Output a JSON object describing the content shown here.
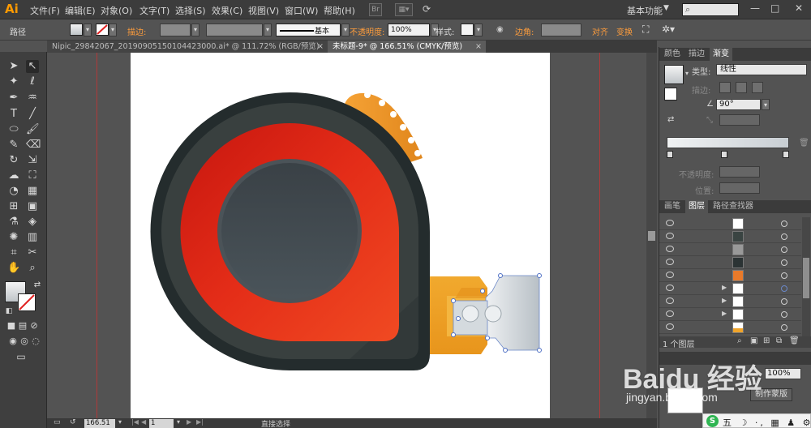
{
  "app": {
    "logo": "Ai"
  },
  "menu": {
    "items": [
      "文件(F)",
      "编辑(E)",
      "对象(O)",
      "文字(T)",
      "选择(S)",
      "效果(C)",
      "视图(V)",
      "窗口(W)",
      "帮助(H)"
    ],
    "br_label": "Br",
    "workspace": "基本功能"
  },
  "controlbar": {
    "selection_label": "路径",
    "stroke_label": "描边:",
    "stroke_style": "基本",
    "opacity_label": "不透明度:",
    "opacity_value": "100%",
    "style_label": "样式:",
    "corner_label": "边角:",
    "align_label": "对齐",
    "transform_label": "变换"
  },
  "tabs": [
    {
      "label": "Nipic_29842067_20190905150104423000.ai* @ 111.72% (RGB/预览)",
      "close": "×"
    },
    {
      "label": "未标题-9* @ 166.51% (CMYK/预览)",
      "close": "×"
    }
  ],
  "statusbar": {
    "zoom": "166.51",
    "page": "1",
    "tool": "直接选择"
  },
  "panels": {
    "top_tabs": [
      "颜色",
      "描边",
      "渐变"
    ],
    "gradient": {
      "type_label": "类型:",
      "type_value": "线性",
      "stroke_label": "描边:",
      "angle_value": "90°",
      "opacity_label": "不透明度:",
      "position_label": "位置:"
    },
    "layer_tabs": [
      "画笔",
      "图层",
      "路径查找器"
    ],
    "layers_count": "1 个图层",
    "transparency": {
      "opacity_value": "100%",
      "make_mask": "制作蒙版"
    }
  },
  "ime": {
    "logo": "S",
    "text": "五 ☽ ·, ▦ ♟ ⚙"
  },
  "watermark": {
    "brand": "Baidu 经验",
    "url": "jingyan.baidu.com"
  },
  "illustration": {
    "description_colors": {
      "outer_ring": "#2b3033",
      "case": "#39403f",
      "red_ring": "#e8301c",
      "center": "#3f474c",
      "tape": "#f0a42a",
      "metal_tip": "#d4dade",
      "knob": "#f29a28"
    }
  }
}
